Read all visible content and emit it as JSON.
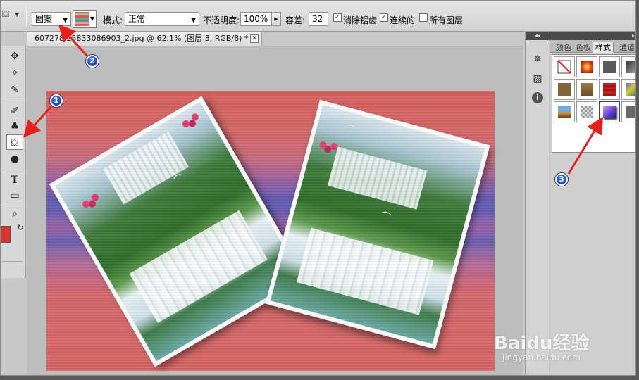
{
  "options_bar": {
    "fill_source": "图案",
    "mode_label": "模式:",
    "mode_value": "正常",
    "opacity_label": "不透明度:",
    "opacity_value": "100%",
    "tolerance_label": "容差:",
    "tolerance_value": "32",
    "antialias_label": "消除锯齿",
    "antialias_checked": true,
    "contiguous_label": "连续的",
    "contiguous_checked": true,
    "all_layers_label": "所有图层",
    "all_layers_checked": false
  },
  "document": {
    "tab_title": "607278  25833086903_2.jpg @ 62.1% (图层 3, RGB/8) *",
    "close_glyph": "✕"
  },
  "toolbox": {
    "tools": [
      {
        "name": "move-tool",
        "glyph": "✥"
      },
      {
        "name": "magic-wand-tool",
        "glyph": "✧"
      },
      {
        "name": "eyedropper-tool",
        "glyph": "✎"
      },
      {
        "name": "brush-tool",
        "glyph": "✐"
      },
      {
        "name": "stamp-tool",
        "glyph": "♣"
      },
      {
        "name": "paint-bucket-tool",
        "glyph": "⛋"
      },
      {
        "name": "blur-tool",
        "glyph": "●"
      },
      {
        "name": "type-tool",
        "glyph": "T"
      },
      {
        "name": "shape-tool",
        "glyph": "▭"
      },
      {
        "name": "zoom-tool",
        "glyph": "🔍"
      }
    ],
    "foreground_color": "#e0332c",
    "background_color": "#ffffff"
  },
  "panel": {
    "tabs": [
      "颜色",
      "色板",
      "样式",
      "通道"
    ],
    "active_tab": "样式",
    "collapse_glyph": "◂◂"
  },
  "annotations": {
    "badge1": "1",
    "badge2": "2",
    "badge3": "3",
    "arrow_color": "#e8201c"
  },
  "watermark": {
    "brand": "Baidu经验",
    "url": "jingyan.baidu.com"
  }
}
